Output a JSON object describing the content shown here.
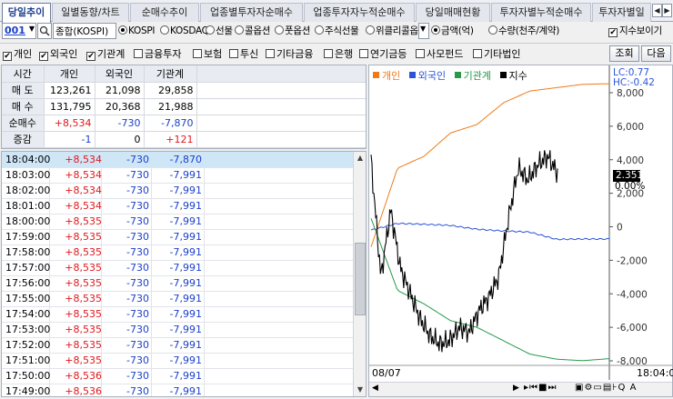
{
  "tabs": [
    "당일추이",
    "일별동향/차트",
    "순매수추이",
    "업종별투자자순매수",
    "업종투자자누적순매수",
    "당일매매현황",
    "투자자별누적순매수",
    "투자자별일"
  ],
  "toolbar": {
    "code": "001",
    "market": "종합(KOSPI)",
    "radios1": [
      "KOSPI",
      "KOSDAQ",
      "선물",
      "콜옵션",
      "풋옵션",
      "주식선물",
      "위클리콜옵."
    ],
    "radios2": [
      "금액(억)",
      "수량(천주/계약)"
    ],
    "index_toggle": "지수보이기"
  },
  "checks": [
    {
      "label": "개인",
      "on": true
    },
    {
      "label": "외국인",
      "on": true
    },
    {
      "label": "기관계",
      "on": true
    },
    {
      "label": "금융투자",
      "on": false
    },
    {
      "label": "보험",
      "on": false
    },
    {
      "label": "투신",
      "on": false
    },
    {
      "label": "기타금융",
      "on": false
    },
    {
      "label": "은행",
      "on": false
    },
    {
      "label": "연기금등",
      "on": false
    },
    {
      "label": "사모펀드",
      "on": false
    },
    {
      "label": "기타법인",
      "on": false
    }
  ],
  "buttons": {
    "query": "조회",
    "next": "다음"
  },
  "summary": {
    "headers": [
      "시간",
      "개인",
      "외국인",
      "기관계"
    ],
    "rows": [
      {
        "label": "매 도",
        "vals": [
          "123,261",
          "21,098",
          "29,858"
        ],
        "cls": [
          "",
          "",
          ""
        ]
      },
      {
        "label": "매 수",
        "vals": [
          "131,795",
          "20,368",
          "21,988"
        ],
        "cls": [
          "",
          "",
          ""
        ]
      },
      {
        "label": "순매수",
        "vals": [
          "+8,534",
          "-730",
          "-7,870"
        ],
        "cls": [
          "red",
          "blu",
          "blu"
        ]
      },
      {
        "label": "증감",
        "vals": [
          "-1",
          "0",
          "+121"
        ],
        "cls": [
          "blu",
          "",
          "red"
        ]
      }
    ]
  },
  "list": [
    [
      "18:04:00",
      "+8,534",
      "-730",
      "-7,870"
    ],
    [
      "18:03:00",
      "+8,534",
      "-730",
      "-7,991"
    ],
    [
      "18:02:00",
      "+8,534",
      "-730",
      "-7,991"
    ],
    [
      "18:01:00",
      "+8,534",
      "-730",
      "-7,991"
    ],
    [
      "18:00:00",
      "+8,535",
      "-730",
      "-7,991"
    ],
    [
      "17:59:00",
      "+8,535",
      "-730",
      "-7,991"
    ],
    [
      "17:58:00",
      "+8,535",
      "-730",
      "-7,991"
    ],
    [
      "17:57:00",
      "+8,535",
      "-730",
      "-7,991"
    ],
    [
      "17:56:00",
      "+8,535",
      "-730",
      "-7,991"
    ],
    [
      "17:55:00",
      "+8,535",
      "-730",
      "-7,991"
    ],
    [
      "17:54:00",
      "+8,535",
      "-730",
      "-7,991"
    ],
    [
      "17:53:00",
      "+8,535",
      "-730",
      "-7,991"
    ],
    [
      "17:52:00",
      "+8,535",
      "-730",
      "-7,991"
    ],
    [
      "17:51:00",
      "+8,535",
      "-730",
      "-7,991"
    ],
    [
      "17:50:00",
      "+8,536",
      "-730",
      "-7,991"
    ],
    [
      "17:49:00",
      "+8,536",
      "-730",
      "-7,991"
    ]
  ],
  "chart": {
    "legend": [
      "개인",
      "외국인",
      "기관계",
      "지수"
    ],
    "colors": {
      "개인": "#f07a1a",
      "외국인": "#2a55d9",
      "기관계": "#279a4a",
      "지수": "#000000"
    },
    "lc": "LC:0.77",
    "hc": "HC:-0.42",
    "right_ticks": [
      "8,000",
      "6,000",
      "4,000",
      "2,000",
      "0",
      "-2,000",
      "-4,000",
      "-6,000",
      "-8,000"
    ],
    "index_box": "2.351",
    "index_pct": "0.00%",
    "date": "08/07",
    "time": "18:04:0"
  },
  "chart_data": {
    "type": "line",
    "ylim": [
      -8000,
      8000
    ],
    "series": [
      {
        "name": "개인",
        "values": [
          -1200,
          3500,
          4200,
          5600,
          6100,
          7400,
          8100,
          8300,
          8500,
          8534
        ]
      },
      {
        "name": "외국인",
        "values": [
          -200,
          200,
          150,
          80,
          -150,
          -250,
          -320,
          -750,
          -730,
          -730
        ]
      },
      {
        "name": "기관계",
        "values": [
          500,
          -3800,
          -4600,
          -5600,
          -6000,
          -6800,
          -7600,
          -7900,
          -7990,
          -7870
        ]
      }
    ]
  }
}
